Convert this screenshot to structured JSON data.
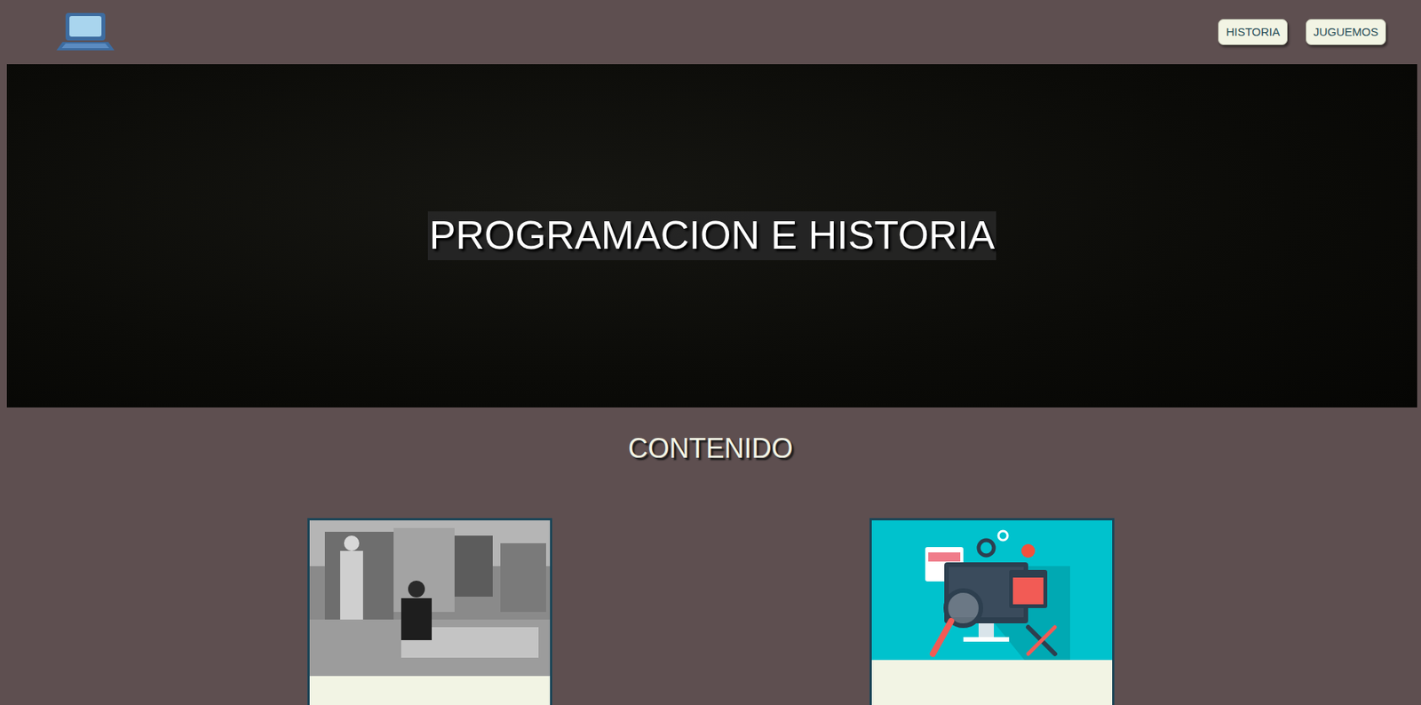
{
  "nav": {
    "buttons": [
      "HISTORIA",
      "JUGUEMOS"
    ]
  },
  "hero": {
    "title": "PROGRAMACION E HISTORIA"
  },
  "section": {
    "title": "CONTENIDO"
  },
  "cards": [
    {
      "kind": "photo"
    },
    {
      "kind": "illustration"
    }
  ]
}
